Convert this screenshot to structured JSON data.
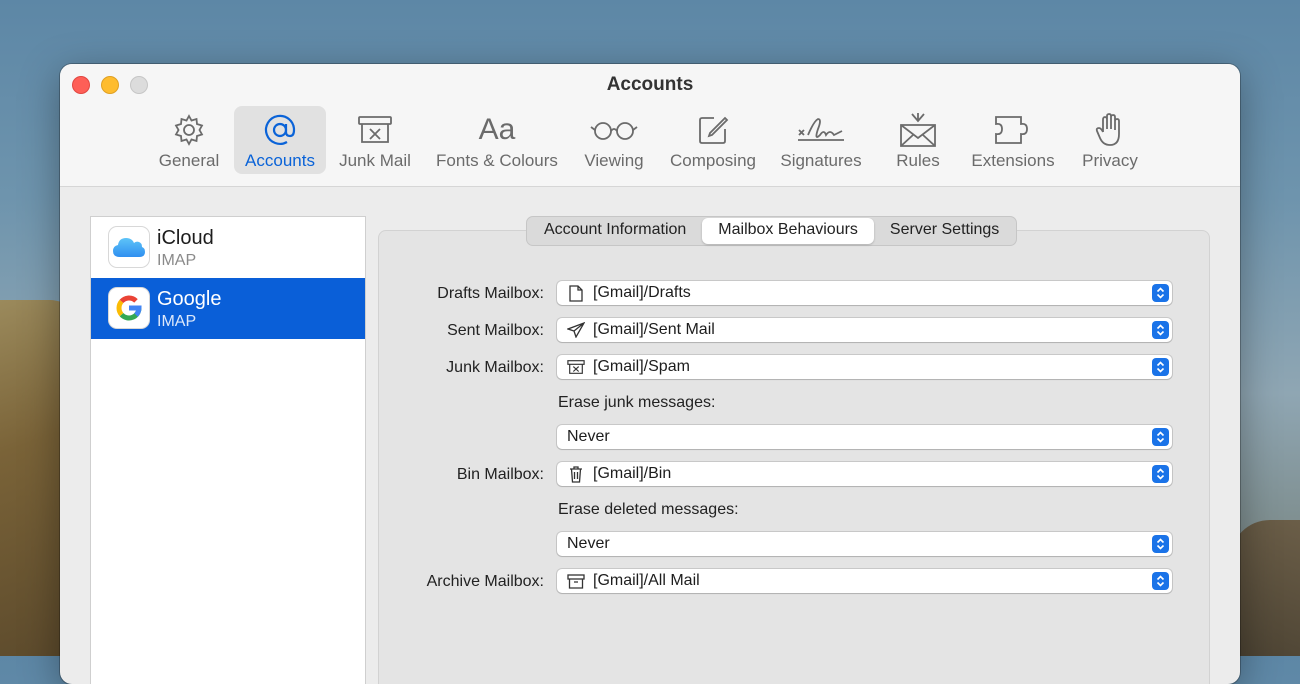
{
  "window": {
    "title": "Accounts"
  },
  "toolbar": [
    {
      "label": "General",
      "icon": "gear-icon"
    },
    {
      "label": "Accounts",
      "icon": "at-icon",
      "active": true
    },
    {
      "label": "Junk Mail",
      "icon": "junk-mail-icon"
    },
    {
      "label": "Fonts & Colours",
      "icon": "fonts-icon",
      "glyph": "Aa"
    },
    {
      "label": "Viewing",
      "icon": "glasses-icon"
    },
    {
      "label": "Composing",
      "icon": "compose-icon"
    },
    {
      "label": "Signatures",
      "icon": "signature-icon"
    },
    {
      "label": "Rules",
      "icon": "rules-icon"
    },
    {
      "label": "Extensions",
      "icon": "extensions-icon"
    },
    {
      "label": "Privacy",
      "icon": "hand-icon"
    }
  ],
  "accounts": [
    {
      "name": "iCloud",
      "type": "IMAP",
      "icon": "icloud-icon"
    },
    {
      "name": "Google",
      "type": "IMAP",
      "icon": "google-icon",
      "selected": true
    }
  ],
  "tabs": [
    "Account Information",
    "Mailbox Behaviours",
    "Server Settings"
  ],
  "active_tab": "Mailbox Behaviours",
  "form": {
    "drafts": {
      "label": "Drafts Mailbox:",
      "value": "[Gmail]/Drafts",
      "icon": "document-icon"
    },
    "sent": {
      "label": "Sent Mailbox:",
      "value": "[Gmail]/Sent Mail",
      "icon": "paper-plane-icon"
    },
    "junk": {
      "label": "Junk Mailbox:",
      "value": "[Gmail]/Spam",
      "icon": "junk-box-icon"
    },
    "erase_junk": {
      "label": "Erase junk messages:",
      "value": "Never"
    },
    "bin": {
      "label": "Bin Mailbox:",
      "value": "[Gmail]/Bin",
      "icon": "trash-icon"
    },
    "erase_deleted": {
      "label": "Erase deleted messages:",
      "value": "Never"
    },
    "archive": {
      "label": "Archive Mailbox:",
      "value": "[Gmail]/All Mail",
      "icon": "archive-box-icon"
    }
  },
  "colors": {
    "accent": "#0a5fd8",
    "selected_row": "#0a5fd8"
  }
}
